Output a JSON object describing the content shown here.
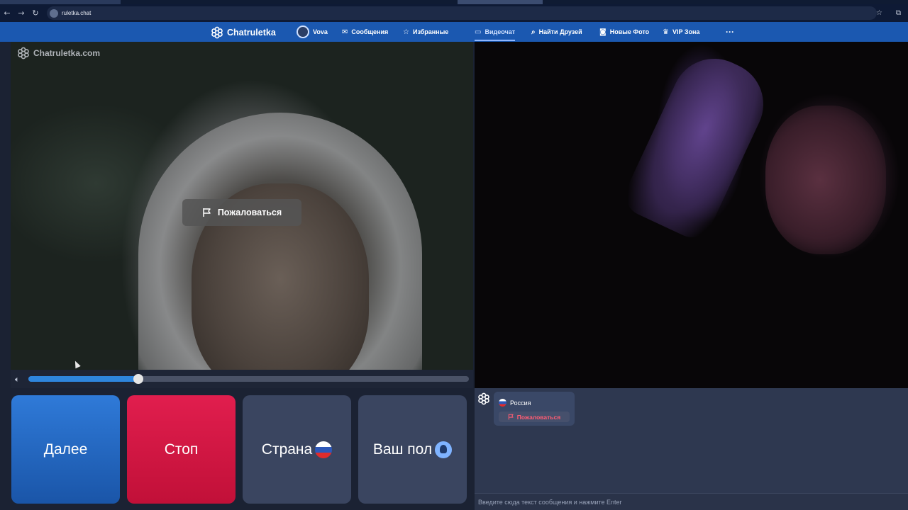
{
  "browser": {
    "url": "ruletka.chat"
  },
  "nav": {
    "brand": "Chatruletka",
    "user": "Vova",
    "items": [
      {
        "label": "Сообщения",
        "icon": "mail-icon"
      },
      {
        "label": "Избранные",
        "icon": "star-icon"
      },
      {
        "label": "Видеочат",
        "icon": "video-icon",
        "active": true
      },
      {
        "label": "Найти Друзей",
        "icon": "search-icon"
      },
      {
        "label": "Новые Фото",
        "icon": "camera-icon"
      },
      {
        "label": "VIP Зона",
        "icon": "crown-icon"
      }
    ],
    "more": "···"
  },
  "left_video": {
    "watermark": "Chatruletka.com",
    "report_label": "Пожаловаться"
  },
  "volume": {
    "level": 0.25
  },
  "buttons": {
    "next": "Далее",
    "stop": "Стоп",
    "country": "Страна",
    "gender": "Ваш пол"
  },
  "chat": {
    "country": "Россия",
    "report_label": "Пожаловаться",
    "input_placeholder": "Введите сюда текст сообщения и нажмите Enter"
  },
  "colors": {
    "nav_bg": "#1b58b0",
    "next_btn": "#2f7ad8",
    "stop_btn": "#e11e4e",
    "secondary_btn": "#3a4560",
    "report_text": "#ff5c73"
  }
}
